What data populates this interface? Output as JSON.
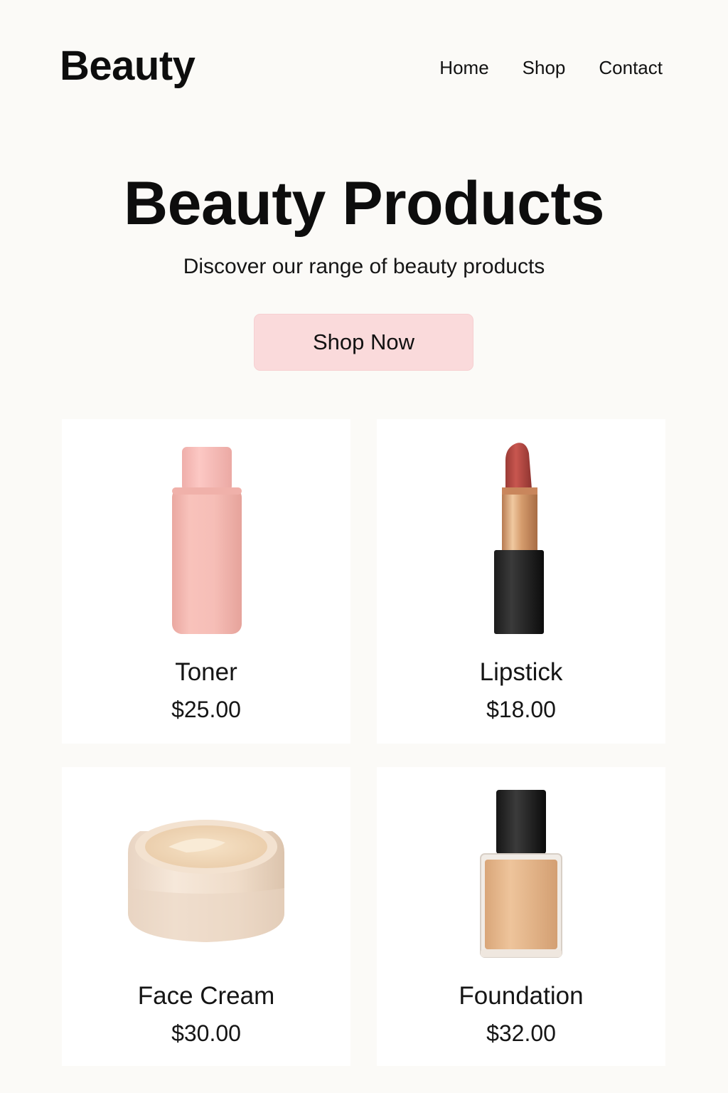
{
  "header": {
    "logo": "Beauty",
    "nav": [
      {
        "label": "Home"
      },
      {
        "label": "Shop"
      },
      {
        "label": "Contact"
      }
    ]
  },
  "hero": {
    "title": "Beauty Products",
    "subtitle": "Discover our range of beauty products",
    "cta_label": "Shop Now",
    "cta_color": "#fadadb"
  },
  "products": [
    {
      "name": "Toner",
      "price": "$25.00",
      "image_icon": "toner-bottle-icon"
    },
    {
      "name": "Lipstick",
      "price": "$18.00",
      "image_icon": "lipstick-icon"
    },
    {
      "name": "Face Cream",
      "price": "$30.00",
      "image_icon": "cream-jar-icon"
    },
    {
      "name": "Foundation",
      "price": "$32.00",
      "image_icon": "foundation-bottle-icon"
    }
  ],
  "colors": {
    "background": "#fbfaf7",
    "card": "#ffffff",
    "text": "#111111"
  }
}
